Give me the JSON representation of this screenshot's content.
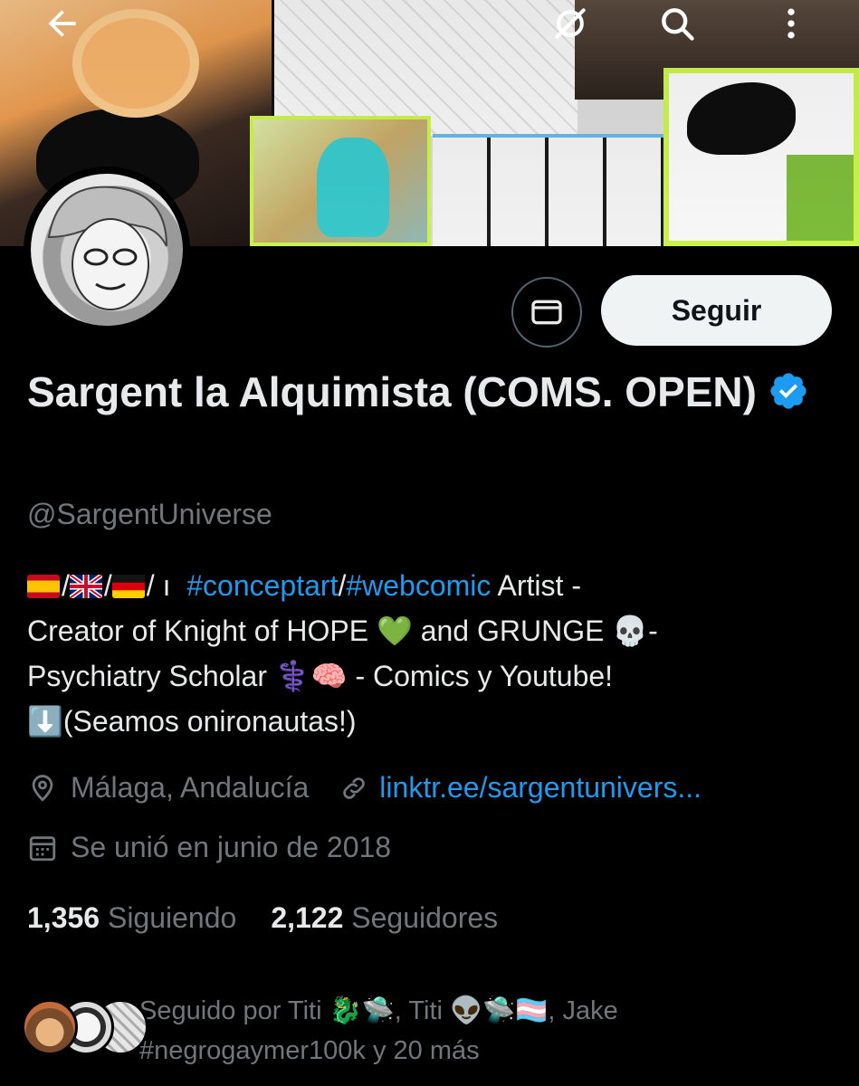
{
  "profile": {
    "name": "Sargent la Alquimista (COMS. OPEN)",
    "handle": "@SargentUniverse",
    "verified_color": "#1d9bf0"
  },
  "actions": {
    "follow_label": "Seguir"
  },
  "bio": {
    "separator1": "/",
    "separator2": "/",
    "separator3": "/",
    "bar": "ı",
    "hashtag1": "#conceptart",
    "slash": "/",
    "hashtag2": "#webcomic",
    "part1": " Artist -",
    "part2": "Creator of Knight of HOPE ",
    "heart": "💚",
    "part3": " and GRUNGE ",
    "skull": "💀",
    "part4": "-",
    "part5": "Psychiatry Scholar ",
    "caduceus": "⚕️",
    "brain": "🧠",
    "part6": " - Comics y Youtube!",
    "arrow": "⬇️",
    "part7": "(Seamos onironautas!)"
  },
  "meta": {
    "location": "Málaga, Andalucía",
    "website": "linktr.ee/sargentunivers...",
    "joined": "Se unió en junio de 2018"
  },
  "stats": {
    "following_count": "1,356",
    "following_label": "Siguiendo",
    "followers_count": "2,122",
    "followers_label": "Seguidores"
  },
  "followed_by": {
    "prefix": "Seguido por Titi ",
    "emoji1": "🐉🛸",
    "mid": ", Titi ",
    "emoji2": "👽🛸🏳️‍⚧️",
    "suffix": ", Jake",
    "line2": "#negrogaymer100k y 20 más"
  },
  "icons": {
    "back": "arrow-left-icon",
    "grok": "grok-icon",
    "search": "search-icon",
    "more": "more-vertical-icon",
    "message": "envelope-icon",
    "location": "location-pin-icon",
    "link": "link-icon",
    "calendar": "calendar-icon"
  },
  "colors": {
    "background": "#000000",
    "text": "#e7e9ea",
    "muted": "#71767b",
    "accent": "#1d9bf0",
    "follow_bg": "#eff3f4"
  }
}
